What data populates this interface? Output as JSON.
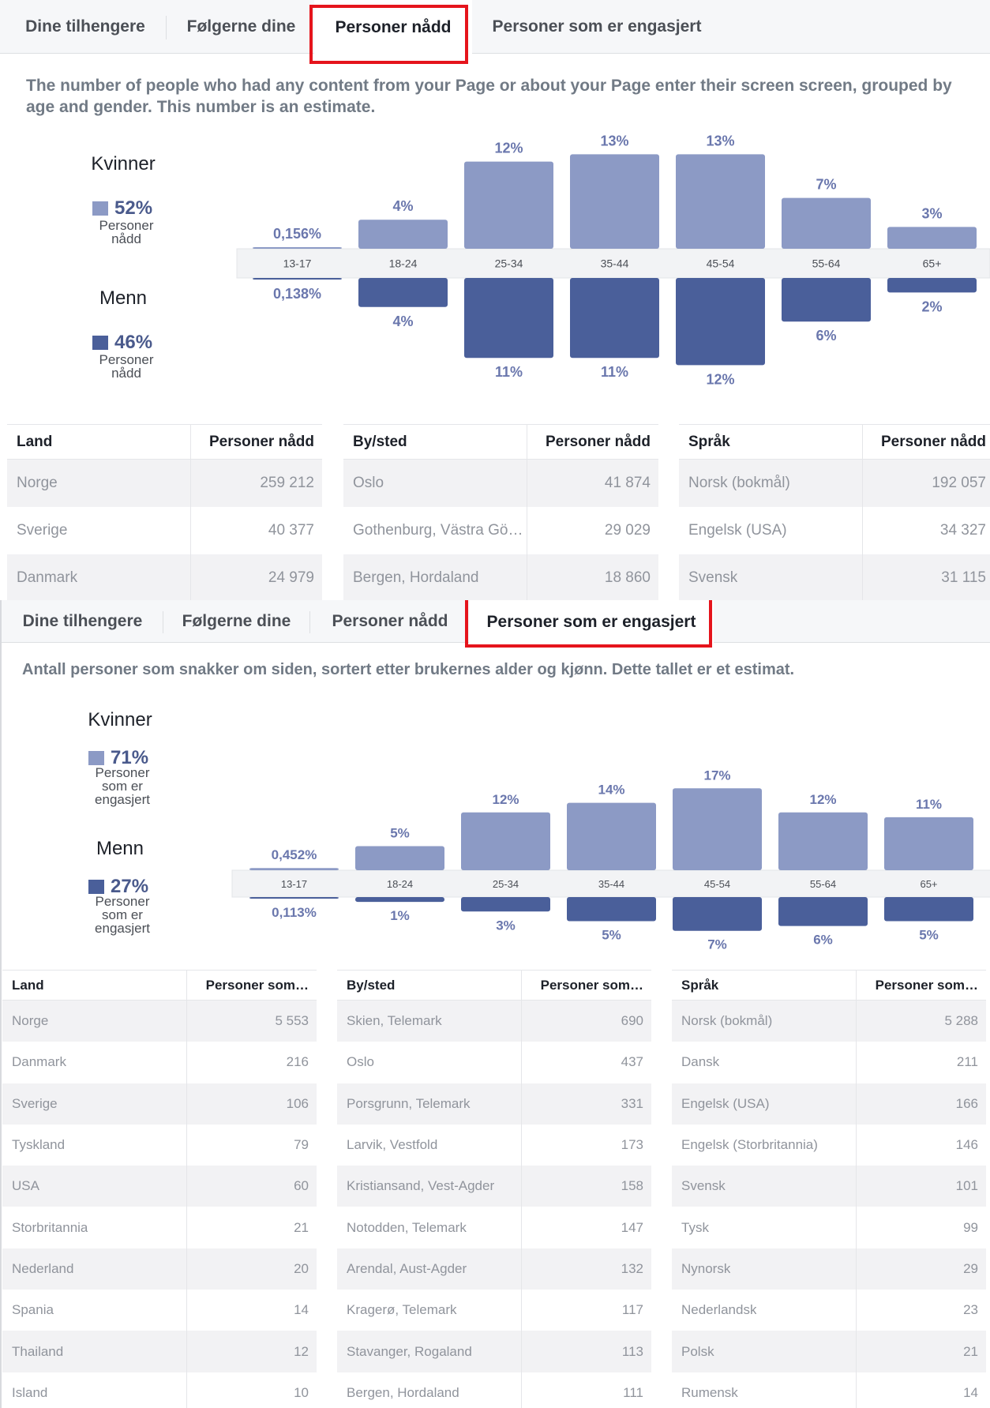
{
  "reached": {
    "tabs": [
      {
        "label": "Dine tilhengere"
      },
      {
        "label": "Følgerne dine"
      },
      {
        "label": "Personer nådd"
      },
      {
        "label": "Personer som er engasjert"
      }
    ],
    "active_tab": "Personer nådd",
    "description": "The number of people who had any content from your Page or about your Page enter their screen screen, grouped by age and gender. This number is an estimate.",
    "legend": {
      "women": {
        "title": "Kvinner",
        "pct": "52%",
        "sub": "Personer nådd"
      },
      "men": {
        "title": "Menn",
        "pct": "46%",
        "sub": "Personer nådd"
      }
    },
    "chart_data": {
      "type": "bar",
      "categories": [
        "13-17",
        "18-24",
        "25-34",
        "35-44",
        "45-54",
        "55-64",
        "65+"
      ],
      "series": [
        {
          "name": "Kvinner",
          "values": [
            0.156,
            4,
            12,
            13,
            13,
            7,
            3
          ],
          "labels": [
            "0,156%",
            "4%",
            "12%",
            "13%",
            "13%",
            "7%",
            "3%"
          ]
        },
        {
          "name": "Menn",
          "values": [
            0.138,
            4,
            11,
            11,
            12,
            6,
            2
          ],
          "labels": [
            "0,138%",
            "4%",
            "11%",
            "11%",
            "12%",
            "6%",
            "2%"
          ]
        }
      ],
      "colors": {
        "women": "#8c9ac5",
        "men": "#4a5f9a"
      }
    },
    "tables": [
      {
        "h1": "Land",
        "h2": "Personer nådd",
        "rows": [
          [
            "Norge",
            "259 212"
          ],
          [
            "Sverige",
            "40 377"
          ],
          [
            "Danmark",
            "24 979"
          ]
        ]
      },
      {
        "h1": "By/sted",
        "h2": "Personer nådd",
        "rows": [
          [
            "Oslo",
            "41 874"
          ],
          [
            "Gothenburg, Västra Gö…",
            "29 029"
          ],
          [
            "Bergen, Hordaland",
            "18 860"
          ]
        ]
      },
      {
        "h1": "Språk",
        "h2": "Personer nådd",
        "rows": [
          [
            "Norsk (bokmål)",
            "192 057"
          ],
          [
            "Engelsk (USA)",
            "34 327"
          ],
          [
            "Svensk",
            "31 115"
          ]
        ]
      }
    ]
  },
  "engaged": {
    "tabs": [
      {
        "label": "Dine tilhengere"
      },
      {
        "label": "Følgerne dine"
      },
      {
        "label": "Personer nådd"
      },
      {
        "label": "Personer som er engasjert"
      }
    ],
    "active_tab": "Personer som er engasjert",
    "description": "Antall personer som snakker om siden, sortert etter brukernes alder og kjønn. Dette tallet er et estimat.",
    "legend": {
      "women": {
        "title": "Kvinner",
        "pct": "71%",
        "sub": "Personer som er engasjert"
      },
      "men": {
        "title": "Menn",
        "pct": "27%",
        "sub": "Personer som er engasjert"
      }
    },
    "chart_data": {
      "type": "bar",
      "categories": [
        "13-17",
        "18-24",
        "25-34",
        "35-44",
        "45-54",
        "55-64",
        "65+"
      ],
      "series": [
        {
          "name": "Kvinner",
          "values": [
            0.452,
            5,
            12,
            14,
            17,
            12,
            11
          ],
          "labels": [
            "0,452%",
            "5%",
            "12%",
            "14%",
            "17%",
            "12%",
            "11%"
          ]
        },
        {
          "name": "Menn",
          "values": [
            0.113,
            1,
            3,
            5,
            7,
            6,
            5
          ],
          "labels": [
            "0,113%",
            "1%",
            "3%",
            "5%",
            "7%",
            "6%",
            "5%"
          ]
        }
      ],
      "colors": {
        "women": "#8c9ac5",
        "men": "#4a5f9a"
      }
    },
    "tables": [
      {
        "h1": "Land",
        "h2": "Personer som…",
        "rows": [
          [
            "Norge",
            "5 553"
          ],
          [
            "Danmark",
            "216"
          ],
          [
            "Sverige",
            "106"
          ],
          [
            "Tyskland",
            "79"
          ],
          [
            "USA",
            "60"
          ],
          [
            "Storbritannia",
            "21"
          ],
          [
            "Nederland",
            "20"
          ],
          [
            "Spania",
            "14"
          ],
          [
            "Thailand",
            "12"
          ],
          [
            "Island",
            "10"
          ]
        ]
      },
      {
        "h1": "By/sted",
        "h2": "Personer som…",
        "rows": [
          [
            "Skien, Telemark",
            "690"
          ],
          [
            "Oslo",
            "437"
          ],
          [
            "Porsgrunn, Telemark",
            "331"
          ],
          [
            "Larvik, Vestfold",
            "173"
          ],
          [
            "Kristiansand, Vest-Agder",
            "158"
          ],
          [
            "Notodden, Telemark",
            "147"
          ],
          [
            "Arendal, Aust-Agder",
            "132"
          ],
          [
            "Kragerø, Telemark",
            "117"
          ],
          [
            "Stavanger, Rogaland",
            "113"
          ],
          [
            "Bergen, Hordaland",
            "111"
          ]
        ]
      },
      {
        "h1": "Språk",
        "h2": "Personer som…",
        "rows": [
          [
            "Norsk (bokmål)",
            "5 288"
          ],
          [
            "Dansk",
            "211"
          ],
          [
            "Engelsk (USA)",
            "166"
          ],
          [
            "Engelsk (Storbritannia)",
            "146"
          ],
          [
            "Svensk",
            "101"
          ],
          [
            "Tysk",
            "99"
          ],
          [
            "Nynorsk",
            "29"
          ],
          [
            "Nederlandsk",
            "23"
          ],
          [
            "Polsk",
            "21"
          ],
          [
            "Rumensk",
            "14"
          ]
        ]
      }
    ]
  }
}
